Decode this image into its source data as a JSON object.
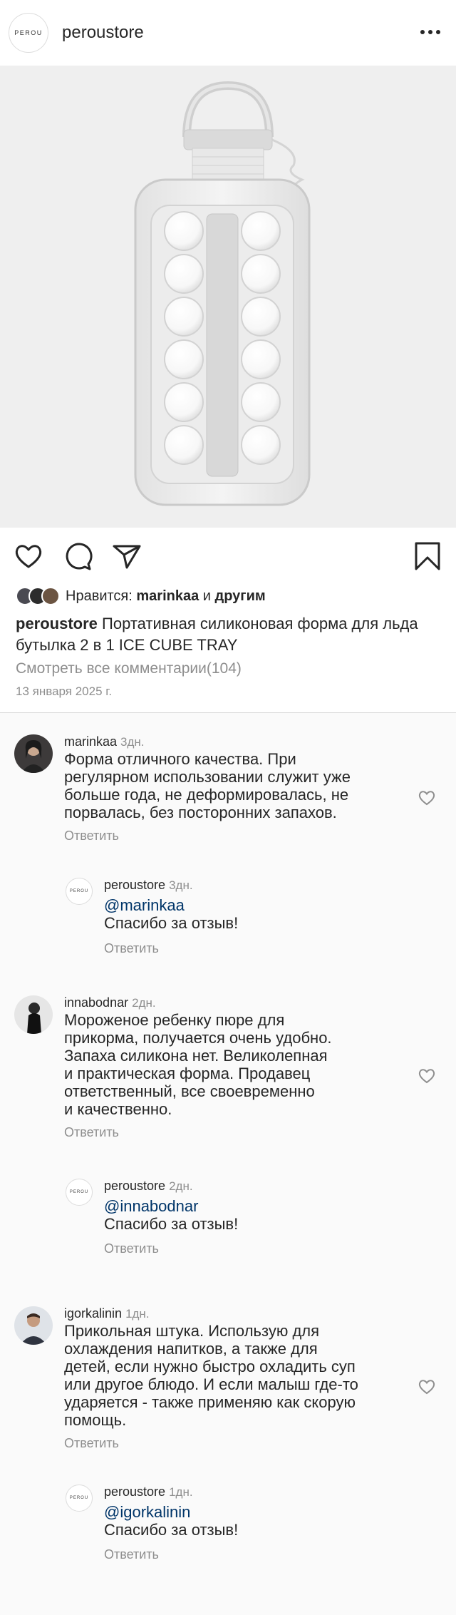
{
  "header": {
    "logo_text": "PEROU",
    "username": "peroustore",
    "more_icon": "more-horizontal-icon"
  },
  "actions": {
    "like_icon": "heart-outline-icon",
    "comment_icon": "comment-icon",
    "share_icon": "send-icon",
    "save_icon": "bookmark-icon"
  },
  "likes": {
    "prefix": "Нравится:",
    "user": "marinkaa",
    "and": "и",
    "others": "другим"
  },
  "caption": {
    "username": "peroustore",
    "text": "Портативная силиконовая форма для льда бутылка 2 в 1 ICE CUBE TRAY"
  },
  "view_all_comments": "Смотреть все комментарии(104)",
  "post_date": "13 января 2025 г.",
  "comments": [
    {
      "username": "marinkaa",
      "time": "3дн.",
      "lines": [
        "Форма отличного качества. При",
        "регулярном использовании служит уже",
        "больше года, не деформировалась, не",
        "порвалась, без посторонних запахов."
      ],
      "reply_label": "Ответить",
      "reply": {
        "username": "peroustore",
        "time": "3дн.",
        "mention": "@marinkaa",
        "text": "Спасибо за отзыв!",
        "reply_label": "Ответить"
      }
    },
    {
      "username": "innabodnar",
      "time": "2дн.",
      "lines": [
        "Мороженое ребенку пюре для",
        "прикорма, получается очень удобно.",
        "Запаха силикона нет. Великолепная",
        "и практическая форма. Продавец",
        "ответственный, все своевременно",
        "и качественно."
      ],
      "reply_label": "Ответить",
      "reply": {
        "username": "peroustore",
        "time": "2дн.",
        "mention": "@innabodnar",
        "text": "Спасибо за отзыв!",
        "reply_label": "Ответить"
      }
    },
    {
      "username": "igorkalinin",
      "time": "1дн.",
      "lines": [
        "Прикольная штука. Использую для",
        "охлаждения напитков, а также для",
        "детей, если нужно быстро охладить суп",
        "или другое блюдо. И если малыш где-то",
        "ударяется - также применяю как скорую",
        "помощь."
      ],
      "reply_label": "Ответить",
      "reply": {
        "username": "peroustore",
        "time": "1дн.",
        "mention": "@igorkalinin",
        "text": "Спасибо за отзыв!",
        "reply_label": "Ответить"
      }
    }
  ],
  "comment_like_icon": "heart-outline-icon",
  "colors": {
    "text": "#262626",
    "muted": "#8e8e8e",
    "mention": "#003569",
    "comments_bg": "#fafafa",
    "photo_bg": "#efefef"
  }
}
